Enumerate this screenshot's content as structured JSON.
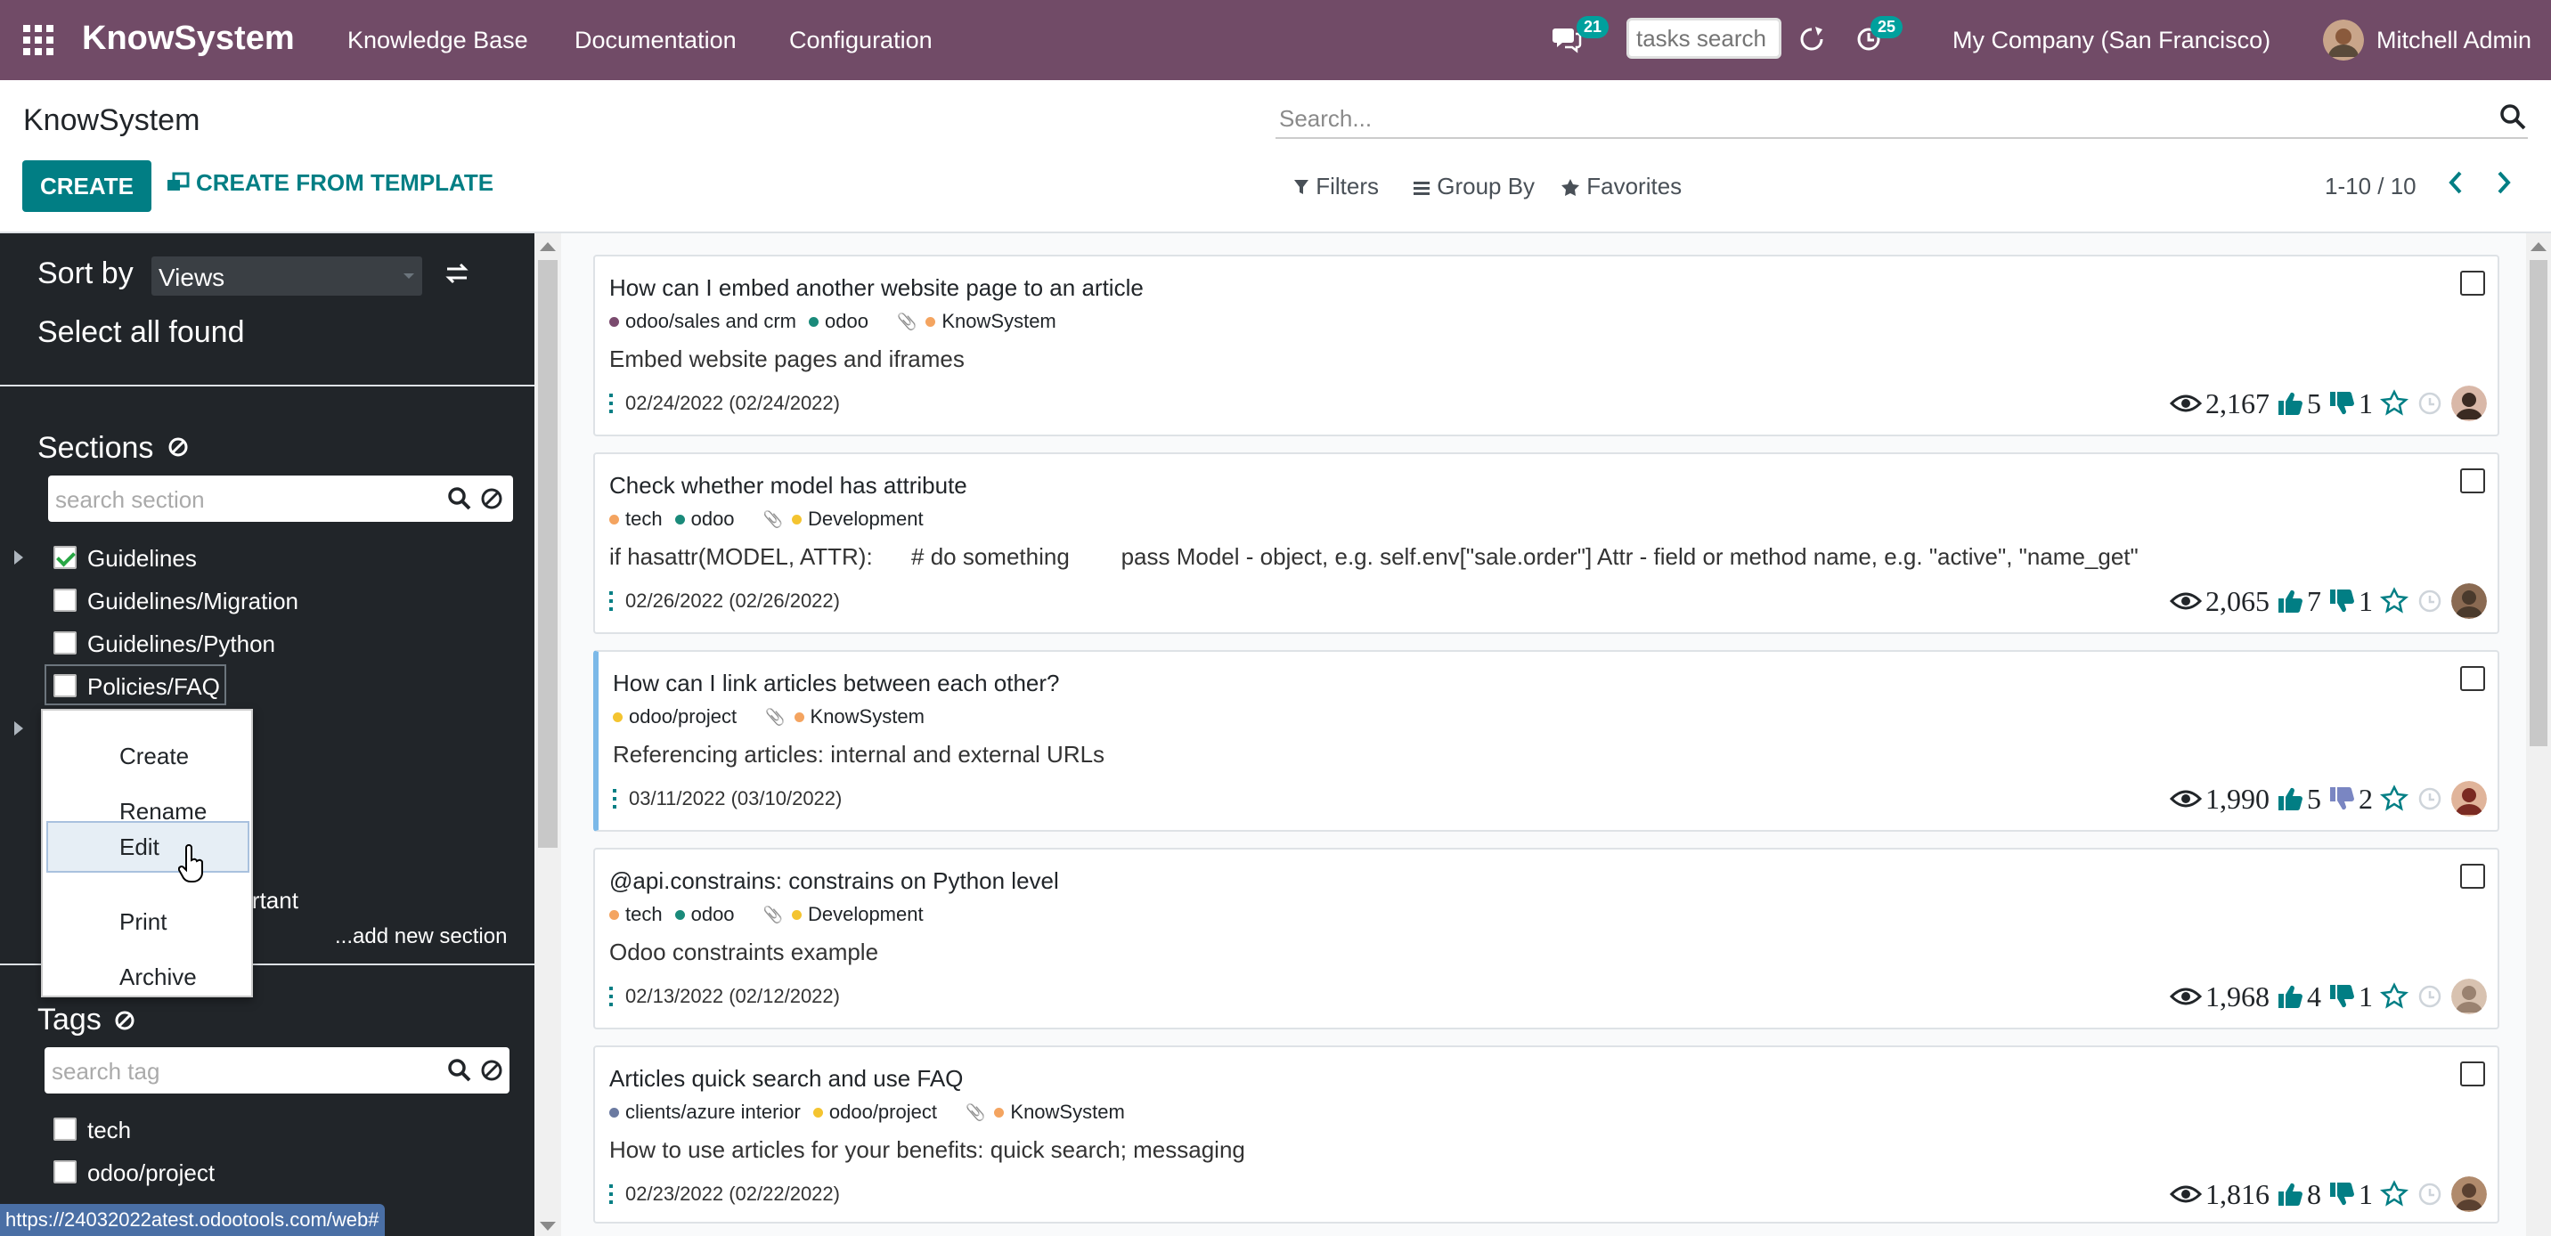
{
  "app": {
    "brand": "KnowSystem",
    "menu": [
      "Knowledge Base",
      "Documentation",
      "Configuration"
    ],
    "messages_count": "21",
    "tasks_search_placeholder": "tasks search",
    "activities_count": "25",
    "company": "My Company (San Francisco)",
    "user": "Mitchell Admin"
  },
  "control": {
    "title": "KnowSystem",
    "create_label": "CREATE",
    "create_template_label": "CREATE FROM TEMPLATE",
    "search_placeholder": "Search...",
    "filters_label": "Filters",
    "group_by_label": "Group By",
    "favorites_label": "Favorites",
    "pager": "1-10 / 10"
  },
  "sidebar": {
    "sort_label": "Sort by",
    "sort_value": "Views",
    "select_all": "Select all found",
    "sections_title": "Sections",
    "section_search_placeholder": "search section",
    "sections": [
      {
        "label": "Guidelines",
        "checked": true
      },
      {
        "label": "Guidelines/Migration",
        "checked": false
      },
      {
        "label": "Guidelines/Python",
        "checked": false
      },
      {
        "label": "Policies/FAQ",
        "checked": false
      }
    ],
    "partial_item": "portant",
    "add_section": "...add new section",
    "tags_title": "Tags",
    "tag_search_placeholder": "search tag",
    "tags": [
      "tech",
      "odoo/project"
    ]
  },
  "context_menu": {
    "items": [
      "Create",
      "Rename",
      "Edit",
      "Print",
      "Archive"
    ],
    "active": "Edit"
  },
  "status_url": "https://24032022atest.odootools.com/web#",
  "colors": {
    "topbar": "#714b67",
    "primary": "#017e84",
    "sidebar": "#212529",
    "badge": "#00a09d"
  },
  "articles": [
    {
      "title": "How can I embed another website page to an article",
      "tags": [
        {
          "label": "odoo/sales and crm",
          "color": "#7a4a6e"
        },
        {
          "label": "odoo",
          "color": "#1a8a7a"
        }
      ],
      "section": {
        "label": "KnowSystem",
        "color": "#f4a460"
      },
      "description": "Embed website pages and iframes",
      "date": "02/24/2022 (02/24/2022)",
      "views": "2,167",
      "likes": "5",
      "dislikes": "1",
      "avatar": "woman-avatar-dark"
    },
    {
      "title": "Check whether model has attribute",
      "tags": [
        {
          "label": "tech",
          "color": "#f4a460"
        },
        {
          "label": "odoo",
          "color": "#1a8a7a"
        }
      ],
      "section": {
        "label": "Development",
        "color": "#f4c430"
      },
      "description": "if hasattr(MODEL, ATTR):      # do something        pass Model - object, e.g. self.env[\"sale.order\"] Attr - field or method name, e.g. \"active\", \"name_get\"",
      "date": "02/26/2022 (02/26/2022)",
      "views": "2,065",
      "likes": "7",
      "dislikes": "1",
      "avatar": "man-avatar-bald"
    },
    {
      "title": "How can I link articles between each other?",
      "tags": [
        {
          "label": "odoo/project",
          "color": "#f4c430"
        }
      ],
      "section": {
        "label": "KnowSystem",
        "color": "#f4a460"
      },
      "description": "Referencing articles: internal and external URLs",
      "date": "03/11/2022 (03/10/2022)",
      "views": "1,990",
      "likes": "5",
      "dislikes": "2",
      "avatar": "woman-avatar-red"
    },
    {
      "title": "@api.constrains: constrains on Python level",
      "tags": [
        {
          "label": "tech",
          "color": "#f4a460"
        },
        {
          "label": "odoo",
          "color": "#1a8a7a"
        }
      ],
      "section": {
        "label": "Development",
        "color": "#f4c430"
      },
      "description": "Odoo constraints example",
      "date": "02/13/2022 (02/12/2022)",
      "views": "1,968",
      "likes": "4",
      "dislikes": "1",
      "avatar": "woman-avatar-light"
    },
    {
      "title": "Articles quick search and use FAQ",
      "tags": [
        {
          "label": "clients/azure interior",
          "color": "#6b7aa1"
        },
        {
          "label": "odoo/project",
          "color": "#f4c430"
        }
      ],
      "section": {
        "label": "KnowSystem",
        "color": "#f4a460"
      },
      "description": "How to use articles for your benefits: quick search; messaging",
      "date": "02/23/2022 (02/22/2022)",
      "views": "1,816",
      "likes": "8",
      "dislikes": "1",
      "avatar": "man-avatar-beard"
    }
  ]
}
